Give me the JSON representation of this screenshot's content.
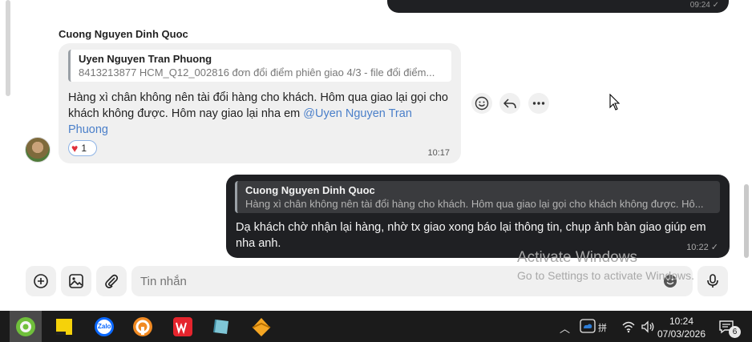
{
  "top_message": {
    "time": "09:24"
  },
  "incoming": {
    "sender": "Cuong Nguyen Dinh Quoc",
    "quote_name": "Uyen Nguyen Tran Phuong",
    "quote_text": "8413213877 HCM_Q12_002816 đơn đổi điểm phiên giao 4/3 - file đổi điểm...",
    "text_before_mention": "Hàng xì chân không nên tài đổi hàng cho khách. Hôm qua giao lại gọi cho khách không được. Hôm nay giao lại nha em ",
    "mention": "@Uyen Nguyen Tran Phuong",
    "reaction_count": "1",
    "time": "10:17"
  },
  "outgoing": {
    "quote_name": "Cuong Nguyen Dinh Quoc",
    "quote_text": "Hàng xì chân không nên tài đổi hàng cho khách. Hôm qua giao lại gọi cho khách không được. Hô...",
    "text": "Dạ khách chờ nhận lại hàng, nhờ tx giao xong báo lại thông tin, chụp ảnh bàn giao giúp em nha anh.",
    "time": "10:22"
  },
  "composer": {
    "placeholder": "Tin nhắn"
  },
  "watermark": {
    "line1": "Activate Windows",
    "line2": "Go to Settings to activate Windows."
  },
  "taskbar": {
    "apps": [
      "coc-coc-icon",
      "sticky-notes-icon",
      "zalo-icon",
      "ultraviewer-icon",
      "wps-office-icon",
      "notebook-icon",
      "sublime-icon"
    ],
    "zalo_label": "Zalo",
    "tray_ime": "拼",
    "time": "10:24",
    "date": "07/03/2026",
    "notification_count": "6"
  },
  "colors": {
    "accent": "#4a7fc9",
    "dark_bubble": "#1f2023",
    "light_bubble": "#f0f0f0",
    "taskbar": "#1b1b1b"
  }
}
